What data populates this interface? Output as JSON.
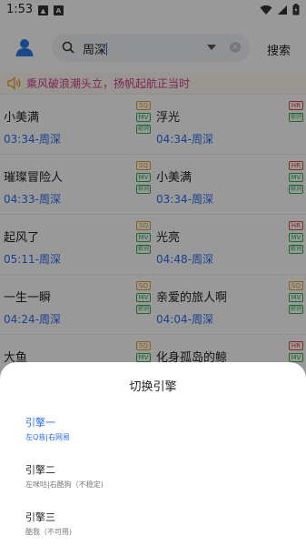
{
  "status_bar": {
    "time": "1:53",
    "battery_icon": "battery-icon",
    "wifi_icon": "wifi-icon",
    "signal_icon": "signal-icon"
  },
  "search": {
    "value": "周深",
    "search_button": "搜索"
  },
  "notice": {
    "text": "乘风破浪潮头立，扬帆起航正当时"
  },
  "songs": [
    {
      "title": "小美满",
      "duration": "03:34",
      "artist": "周深",
      "tags": [
        "SQ",
        "MV",
        "ci"
      ]
    },
    {
      "title": "浮光",
      "duration": "04:34",
      "artist": "周深",
      "tags": [
        "HR",
        "ci"
      ]
    },
    {
      "title": "璀璨冒险人",
      "duration": "04:33",
      "artist": "周深",
      "tags": [
        "SQ",
        "MV",
        "ci"
      ]
    },
    {
      "title": "小美满",
      "duration": "03:34",
      "artist": "周深",
      "tags": [
        "HR",
        "MV",
        "ci"
      ]
    },
    {
      "title": "起风了",
      "duration": "05:11",
      "artist": "周深",
      "tags": [
        "SQ",
        "MV",
        "ci"
      ]
    },
    {
      "title": "光亮",
      "duration": "04:48",
      "artist": "周深",
      "tags": [
        "HR",
        "MV",
        "ci"
      ]
    },
    {
      "title": "一生一瞬",
      "duration": "04:24",
      "artist": "周深",
      "tags": [
        "SQ",
        "MV",
        "ci"
      ]
    },
    {
      "title": "亲爱的旅人啊",
      "duration": "04:04",
      "artist": "周深",
      "tags": [
        "SQ",
        "MV",
        "ci"
      ]
    },
    {
      "title": "大鱼",
      "duration": "",
      "artist": "",
      "tags": [
        "SQ",
        "MV"
      ]
    },
    {
      "title": "化身孤岛的鲸",
      "duration": "",
      "artist": "",
      "tags": [
        "HR",
        "MV"
      ]
    }
  ],
  "tag_labels": {
    "SQ": "SQ",
    "HR": "HR",
    "MV": "MV",
    "ci": "歌词"
  },
  "sheet": {
    "title": "切换引擎",
    "engines": [
      {
        "name": "引擎一",
        "desc": "左Q音|右网易",
        "active": true
      },
      {
        "name": "引擎二",
        "desc": "左咪咕|右酷狗（不稳定)",
        "active": false
      },
      {
        "name": "引擎三",
        "desc": "酷我（不可用)",
        "active": false
      }
    ]
  },
  "colors": {
    "accent": "#2a6cf0",
    "notice_text": "#d33d8e",
    "tag_sq": "#e5a024",
    "tag_hr": "#e0483a",
    "tag_mv": "#2eb04f"
  }
}
